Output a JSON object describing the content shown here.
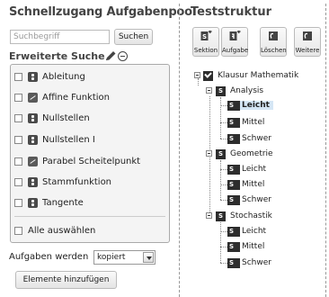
{
  "left": {
    "title": "Schnellzugang Aufgabenpool",
    "search": {
      "placeholder": "Suchbegriff",
      "button": "Suchen"
    },
    "advanced": {
      "title": "Erweiterte Suche",
      "items": [
        {
          "label": "Ableitung",
          "icon": "bolt-icon",
          "checked": false
        },
        {
          "label": "Affine Funktion",
          "icon": "graph-icon",
          "checked": false
        },
        {
          "label": "Nullstellen",
          "icon": "bolt-icon",
          "checked": false
        },
        {
          "label": "Nullstellen I",
          "icon": "bolt-icon",
          "checked": false
        },
        {
          "label": "Parabel Scheitelpunkt",
          "icon": "graph-icon",
          "checked": false
        },
        {
          "label": "Stammfunktion",
          "icon": "bolt-icon",
          "checked": false
        },
        {
          "label": "Tangente",
          "icon": "bolt-icon",
          "checked": false
        }
      ],
      "select_all": "Alle auswählen"
    },
    "tasks_mode": {
      "label": "Aufgaben werden",
      "value": "kopiert"
    },
    "add_button": "Elemente hinzufügen"
  },
  "right": {
    "title": "Teststruktur",
    "toolbar": [
      {
        "label": "Sektion",
        "icon": "section-icon"
      },
      {
        "label": "Aufgabe",
        "icon": "task-icon"
      },
      {
        "label": "Löschen",
        "icon": "delete-icon"
      },
      {
        "label": "Weitere",
        "icon": "more-icon"
      }
    ],
    "tree": {
      "root": "Klausur Mathematik",
      "sections": [
        {
          "name": "Analysis",
          "children": [
            "Leicht",
            "Mittel",
            "Schwer"
          ]
        },
        {
          "name": "Geometrie",
          "children": [
            "Leicht",
            "Mittel",
            "Schwer"
          ]
        },
        {
          "name": "Stochastik",
          "children": [
            "Leicht",
            "Mittel",
            "Schwer"
          ]
        }
      ],
      "selected": "Analysis / Leicht",
      "section_badge": "S"
    }
  }
}
